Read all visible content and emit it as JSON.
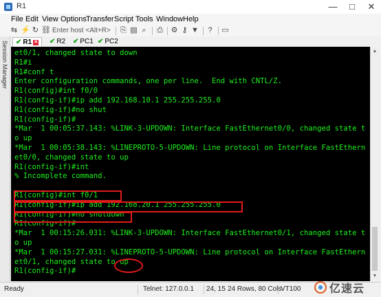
{
  "window": {
    "title": "R1",
    "controls": [
      "—",
      "□",
      "✕"
    ]
  },
  "menu": [
    "File",
    "Edit",
    "View",
    "Options",
    "Transfer",
    "Script",
    "Tools",
    "Window",
    "Help"
  ],
  "toolbar": {
    "host_placeholder": "Enter host <Alt+R>",
    "icons": [
      "connect-icon",
      "lightning-icon",
      "reconnect-icon",
      "link-icon",
      "copy-icon",
      "paste-icon",
      "find-icon",
      "print-icon",
      "settings-icon",
      "key-icon",
      "filter-icon",
      "help-icon",
      "monitor-icon"
    ]
  },
  "sidebar": {
    "label": "Session Manager"
  },
  "tabs": [
    {
      "label": "R1",
      "active": true
    },
    {
      "label": "R2",
      "active": false
    },
    {
      "label": "PC1",
      "active": false
    },
    {
      "label": "PC2",
      "active": false
    }
  ],
  "terminal": {
    "lines": [
      "et0/1, changed state to down",
      "R1#i",
      "R1#conf t",
      "Enter configuration commands, one per line.  End with CNTL/Z.",
      "R1(config)#int f0/0",
      "R1(config-if)#ip add 192.168.10.1 255.255.255.0",
      "R1(config-if)#no shut",
      "R1(config-if)#",
      "*Mar  1 00:05:37.143: %LINK-3-UPDOWN: Interface FastEthernet0/0, changed state t",
      "o up",
      "*Mar  1 00:05:38.143: %LINEPROTO-5-UPDOWN: Line protocol on Interface FastEthern",
      "et0/0, changed state to up",
      "R1(config-if)#int",
      "% Incomplete command.",
      "",
      "R1(config)#int f0/1",
      "R1(config-if)#ip add 192.168.20.1 255.255.255.0",
      "R1(config-if)#no shutdown",
      "R1(config-if)#",
      "*Mar  1 00:15:26.031: %LINK-3-UPDOWN: Interface FastEthernet0/1, changed state t",
      "o up",
      "*Mar  1 00:15:27.031: %LINEPROTO-5-UPDOWN: Line protocol on Interface FastEthern",
      "et0/1, changed state to up",
      "R1(config-if)#"
    ]
  },
  "status": {
    "ready": "Ready",
    "telnet": "Telnet: 127.0.0.1",
    "cursor": "24, 15",
    "size": "24 Rows, 80 Cols",
    "terminal_type": "VT100"
  },
  "watermark": {
    "text": "亿速云"
  },
  "colors": {
    "terminal_bg": "#000000",
    "terminal_fg": "#1ef01e",
    "highlight": "#e21b1b",
    "tab_check": "#1aa01a"
  }
}
